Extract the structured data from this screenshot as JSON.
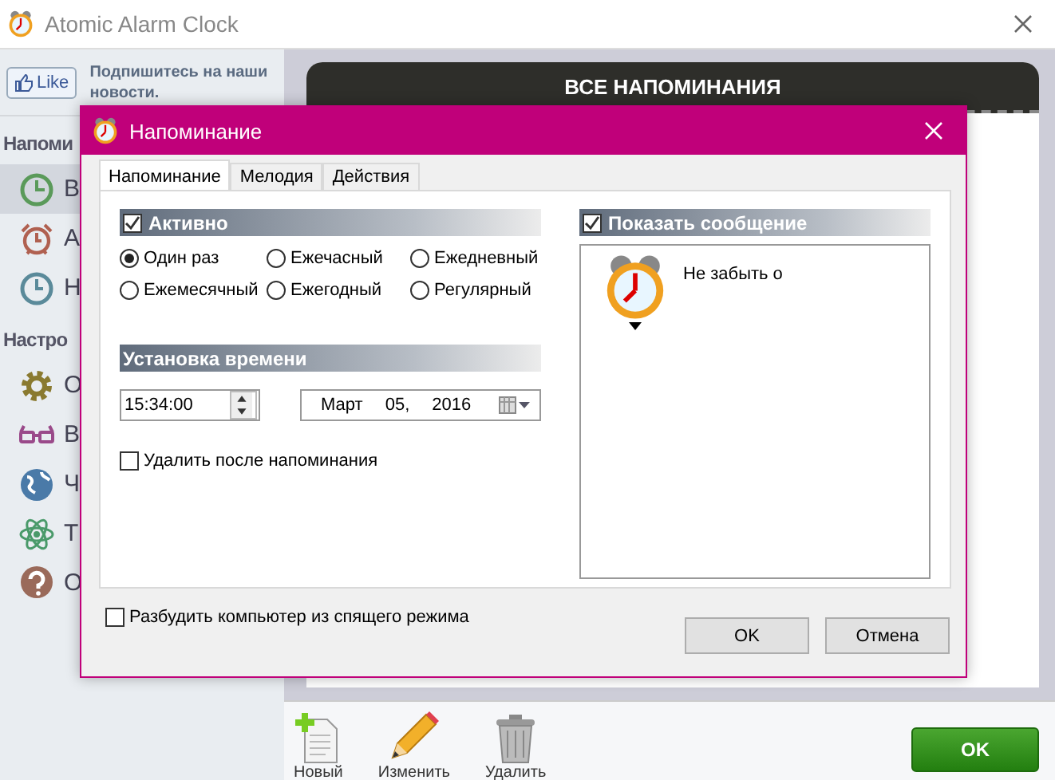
{
  "window": {
    "title": "Atomic Alarm Clock"
  },
  "sidebar": {
    "like": "Like",
    "subscribe": "Подпишитесь на наши новости.",
    "sections": [
      {
        "title": "Напоми",
        "items": [
          {
            "label": "В",
            "selected": true
          },
          {
            "label": "А",
            "selected": false
          },
          {
            "label": "Н",
            "selected": false
          }
        ]
      },
      {
        "title": "Настро",
        "items": [
          {
            "label": "О",
            "selected": false
          },
          {
            "label": "В",
            "selected": false
          },
          {
            "label": "Ч",
            "selected": false
          },
          {
            "label": "Т",
            "selected": false
          },
          {
            "label": "О",
            "selected": false
          }
        ]
      }
    ]
  },
  "panel": {
    "title": "ВСЕ НАПОМИНАНИЯ"
  },
  "toolbar": {
    "items": [
      {
        "label": "Новый"
      },
      {
        "label": "Изменить"
      },
      {
        "label": "Удалить"
      }
    ],
    "ok": "OK"
  },
  "dialog": {
    "title": "Напоминание",
    "tabs": [
      {
        "label": "Напоминание",
        "selected": true
      },
      {
        "label": "Мелодия",
        "selected": false
      },
      {
        "label": "Действия",
        "selected": false
      }
    ],
    "active": {
      "label": "Активно",
      "checked": true
    },
    "repeat": [
      {
        "label": "Один раз",
        "selected": true
      },
      {
        "label": "Ежечасный",
        "selected": false
      },
      {
        "label": "Ежедневный",
        "selected": false
      },
      {
        "label": "Ежемесячный",
        "selected": false
      },
      {
        "label": "Ежегодный",
        "selected": false
      },
      {
        "label": "Регулярный",
        "selected": false
      }
    ],
    "time_section": "Установка времени",
    "time": "15:34:00",
    "date": {
      "month": "Март",
      "day": "05,",
      "year": "2016"
    },
    "delete_after": {
      "label": "Удалить после напоминания",
      "checked": false
    },
    "show_message": {
      "label": "Показать сообщение",
      "checked": true
    },
    "message": "Не забыть о",
    "wake": {
      "label": "Разбудить компьютер из спящего режима",
      "checked": false
    },
    "buttons": [
      "OK",
      "Отмена"
    ]
  }
}
